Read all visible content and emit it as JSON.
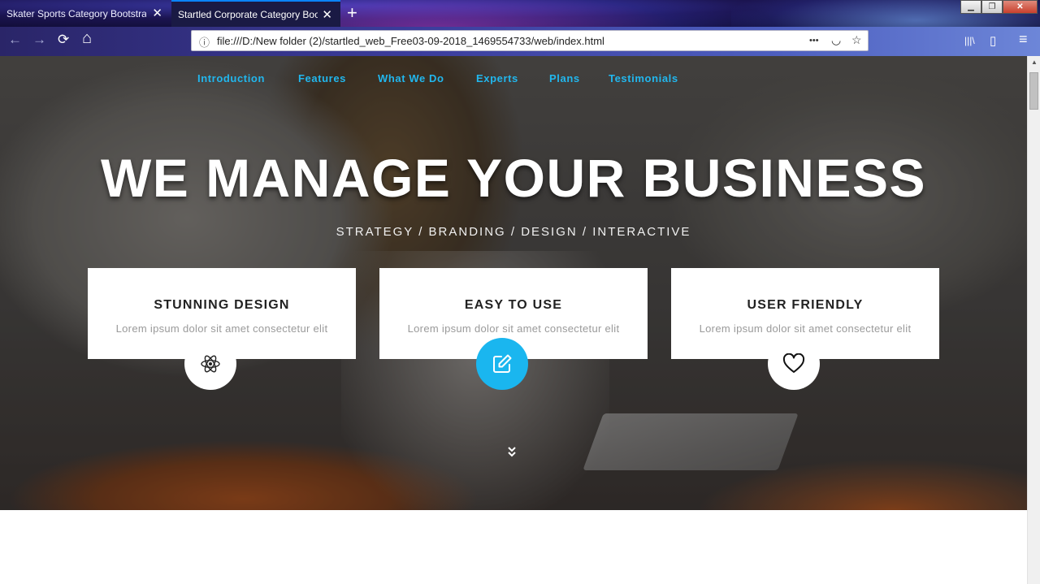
{
  "browser": {
    "tabs": [
      {
        "title": "Skater Sports Category Bootstrap Re",
        "active": false
      },
      {
        "title": "Startled Corporate Category Bootstr",
        "active": true
      }
    ],
    "new_tab_symbol": "+",
    "close_symbol": "✕",
    "url": "file:///D:/New folder (2)/startled_web_Free03-09-2018_1469554733/web/index.html",
    "window_controls": {
      "minimize": "▁",
      "restore": "❐",
      "close": "✕"
    },
    "icons": {
      "back": "back-arrow-icon",
      "forward": "forward-arrow-icon",
      "reload": "reload-icon",
      "home": "home-icon",
      "info": "info-icon",
      "more": "more-actions-icon",
      "pocket": "pocket-icon",
      "bookmark": "star-icon",
      "library": "library-icon",
      "sidebar": "sidebar-icon",
      "menu": "hamburger-menu-icon"
    },
    "glyphs": {
      "back": "←",
      "forward": "→",
      "reload": "⟳",
      "home": "⌂",
      "info": "ⓘ",
      "more": "•••",
      "pocket": "◡",
      "star": "☆",
      "library": "|||\\",
      "sidebar": "▯",
      "menu": "≡"
    }
  },
  "site": {
    "nav": [
      "Introduction",
      "Features",
      "What We Do",
      "Experts",
      "Plans",
      "Testimonials"
    ],
    "hero": {
      "title": "WE MANAGE YOUR BUSINESS",
      "subtitle": "STRATEGY / BRANDING / DESIGN / INTERACTIVE"
    },
    "cards": [
      {
        "title": "STUNNING DESIGN",
        "text": "Lorem ipsum dolor sit amet consectetur elit",
        "icon": "atom-icon"
      },
      {
        "title": "EASY TO USE",
        "text": "Lorem ipsum dolor sit amet consectetur elit",
        "icon": "edit-icon"
      },
      {
        "title": "USER FRIENDLY",
        "text": "Lorem ipsum dolor sit amet consectetur elit",
        "icon": "heart-icon"
      }
    ],
    "scroll_down_symbol": "⌄⌄",
    "colors": {
      "accent": "#1ab6ef",
      "nav_link": "#21b7ee",
      "card_title": "#222222",
      "card_text": "#9a9a9a"
    }
  }
}
